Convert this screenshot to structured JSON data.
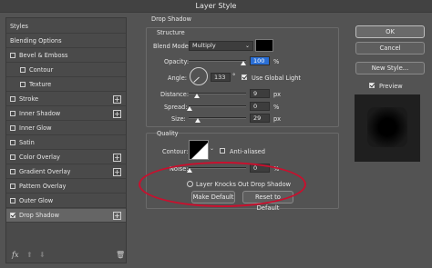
{
  "window": {
    "title": "Layer Style"
  },
  "styles_panel": {
    "items": [
      {
        "label": "Styles",
        "checkbox": false,
        "checked": false,
        "plus": false,
        "indent": false,
        "selected": false
      },
      {
        "label": "Blending Options",
        "checkbox": false,
        "checked": false,
        "plus": false,
        "indent": false,
        "selected": false
      },
      {
        "label": "Bevel & Emboss",
        "checkbox": true,
        "checked": false,
        "plus": false,
        "indent": false,
        "selected": false
      },
      {
        "label": "Contour",
        "checkbox": true,
        "checked": false,
        "plus": false,
        "indent": true,
        "selected": false
      },
      {
        "label": "Texture",
        "checkbox": true,
        "checked": false,
        "plus": false,
        "indent": true,
        "selected": false
      },
      {
        "label": "Stroke",
        "checkbox": true,
        "checked": false,
        "plus": true,
        "indent": false,
        "selected": false
      },
      {
        "label": "Inner Shadow",
        "checkbox": true,
        "checked": false,
        "plus": true,
        "indent": false,
        "selected": false
      },
      {
        "label": "Inner Glow",
        "checkbox": true,
        "checked": false,
        "plus": false,
        "indent": false,
        "selected": false
      },
      {
        "label": "Satin",
        "checkbox": true,
        "checked": false,
        "plus": false,
        "indent": false,
        "selected": false
      },
      {
        "label": "Color Overlay",
        "checkbox": true,
        "checked": false,
        "plus": true,
        "indent": false,
        "selected": false
      },
      {
        "label": "Gradient Overlay",
        "checkbox": true,
        "checked": false,
        "plus": true,
        "indent": false,
        "selected": false
      },
      {
        "label": "Pattern Overlay",
        "checkbox": true,
        "checked": false,
        "plus": false,
        "indent": false,
        "selected": false
      },
      {
        "label": "Outer Glow",
        "checkbox": true,
        "checked": false,
        "plus": false,
        "indent": false,
        "selected": false
      },
      {
        "label": "Drop Shadow",
        "checkbox": true,
        "checked": true,
        "plus": true,
        "indent": false,
        "selected": true
      }
    ],
    "footer": {
      "fx": "fx",
      "up": "⬆",
      "down": "⬇",
      "trash": "🗑"
    }
  },
  "drop_shadow": {
    "title": "Drop Shadow",
    "structure": {
      "title": "Structure",
      "blend_mode_label": "Blend Mode:",
      "blend_mode_value": "Multiply",
      "shadow_color": "#000000",
      "opacity_label": "Opacity:",
      "opacity_value": "100",
      "opacity_unit": "%",
      "opacity_fraction": 1.0,
      "angle_label": "Angle:",
      "angle_value": "133",
      "angle_unit": "°",
      "use_global_light_label": "Use Global Light",
      "use_global_light_checked": true,
      "distance_label": "Distance:",
      "distance_value": "9",
      "distance_unit": "px",
      "spread_label": "Spread:",
      "spread_value": "0",
      "spread_unit": "%",
      "size_label": "Size:",
      "size_value": "29",
      "size_unit": "px"
    },
    "quality": {
      "title": "Quality",
      "contour_label": "Contour:",
      "anti_aliased_label": "Anti-aliased",
      "anti_aliased_checked": false,
      "noise_label": "Noise:",
      "noise_value": "0",
      "noise_unit": "%",
      "layer_knocks_out_label": "Layer Knocks Out Drop Shadow",
      "make_default_label": "Make Default",
      "reset_to_default_label": "Reset to Default"
    }
  },
  "actions": {
    "ok_label": "OK",
    "cancel_label": "Cancel",
    "new_style_label": "New Style...",
    "preview_label": "Preview",
    "preview_checked": true
  },
  "colors": {
    "annotation_ellipse": "#c8102e",
    "highlight_field": "#2a6fd6"
  }
}
